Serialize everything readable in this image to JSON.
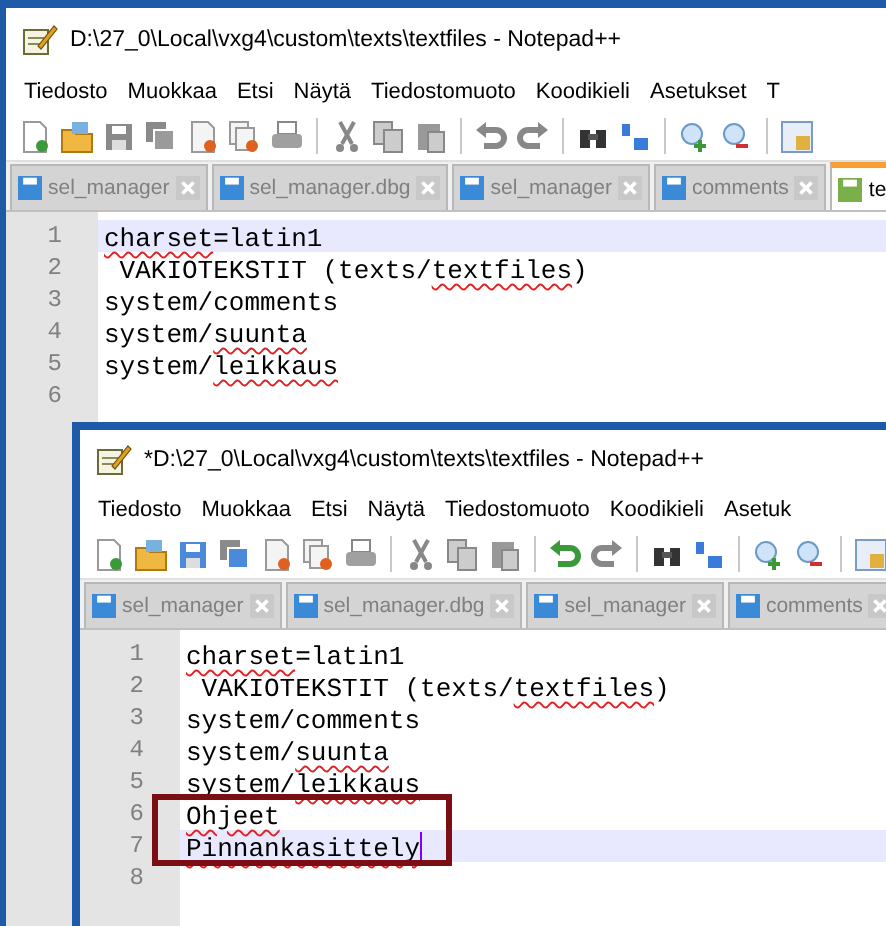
{
  "windows": [
    {
      "title": "D:\\27_0\\Local\\vxg4\\custom\\texts\\textfiles - Notepad++",
      "unsaved": false,
      "menu": [
        "Tiedosto",
        "Muokkaa",
        "Etsi",
        "Näytä",
        "Tiedostomuoto",
        "Koodikieli",
        "Asetukset",
        "T"
      ],
      "tabs": [
        {
          "label": "sel_manager",
          "selected": false
        },
        {
          "label": "sel_manager.dbg",
          "selected": false
        },
        {
          "label": "sel_manager",
          "selected": false
        },
        {
          "label": "comments",
          "selected": false
        },
        {
          "label": "te",
          "selected": true
        }
      ],
      "lines": [
        {
          "number": "1",
          "current": true,
          "boxed": false,
          "segments": [
            {
              "text": "charset",
              "misspelled": true
            },
            {
              "text": "=latin1",
              "misspelled": false
            }
          ]
        },
        {
          "number": "2",
          "current": false,
          "boxed": false,
          "segments": [
            {
              "text": " VAKIOTEKSTIT (texts/",
              "misspelled": false
            },
            {
              "text": "textfiles",
              "misspelled": true
            },
            {
              "text": ")",
              "misspelled": false
            }
          ]
        },
        {
          "number": "3",
          "current": false,
          "boxed": false,
          "segments": [
            {
              "text": "system/comments",
              "misspelled": false
            }
          ]
        },
        {
          "number": "4",
          "current": false,
          "boxed": false,
          "segments": [
            {
              "text": "system/",
              "misspelled": false
            },
            {
              "text": "suunta",
              "misspelled": true
            }
          ]
        },
        {
          "number": "5",
          "current": false,
          "boxed": false,
          "segments": [
            {
              "text": "system/",
              "misspelled": false
            },
            {
              "text": "leikkaus",
              "misspelled": true
            }
          ]
        },
        {
          "number": "6",
          "current": false,
          "boxed": false
        }
      ]
    },
    {
      "title": "*D:\\27_0\\Local\\vxg4\\custom\\texts\\textfiles - Notepad++",
      "unsaved": true,
      "menu": [
        "Tiedosto",
        "Muokkaa",
        "Etsi",
        "Näytä",
        "Tiedostomuoto",
        "Koodikieli",
        "Asetuk"
      ],
      "tabs": [
        {
          "label": "sel_manager",
          "selected": false
        },
        {
          "label": "sel_manager.dbg",
          "selected": false
        },
        {
          "label": "sel_manager",
          "selected": false
        },
        {
          "label": "comments",
          "selected": false
        }
      ],
      "lines": [
        {
          "number": "1",
          "current": false,
          "boxed": false,
          "segments": [
            {
              "text": "charset",
              "misspelled": true
            },
            {
              "text": "=latin1",
              "misspelled": false
            }
          ]
        },
        {
          "number": "2",
          "current": false,
          "boxed": false,
          "segments": [
            {
              "text": " VAKIOTEKSTIT (texts/",
              "misspelled": false
            },
            {
              "text": "textfiles",
              "misspelled": true
            },
            {
              "text": ")",
              "misspelled": false
            }
          ]
        },
        {
          "number": "3",
          "current": false,
          "boxed": false,
          "segments": [
            {
              "text": "system/comments",
              "misspelled": false
            }
          ]
        },
        {
          "number": "4",
          "current": false,
          "boxed": false,
          "segments": [
            {
              "text": "system/",
              "misspelled": false
            },
            {
              "text": "suunta",
              "misspelled": true
            }
          ]
        },
        {
          "number": "5",
          "current": false,
          "boxed": false,
          "segments": [
            {
              "text": "system/",
              "misspelled": false
            },
            {
              "text": "leikkaus",
              "misspelled": true
            }
          ]
        },
        {
          "number": "6",
          "current": false,
          "boxed": true,
          "segments": [
            {
              "text": "Ohjeet",
              "misspelled": true
            }
          ]
        },
        {
          "number": "7",
          "current": true,
          "boxed": true,
          "segments": [
            {
              "text": "Pinnankasittely",
              "misspelled": true
            }
          ]
        },
        {
          "number": "8",
          "current": false,
          "boxed": false
        }
      ]
    }
  ]
}
